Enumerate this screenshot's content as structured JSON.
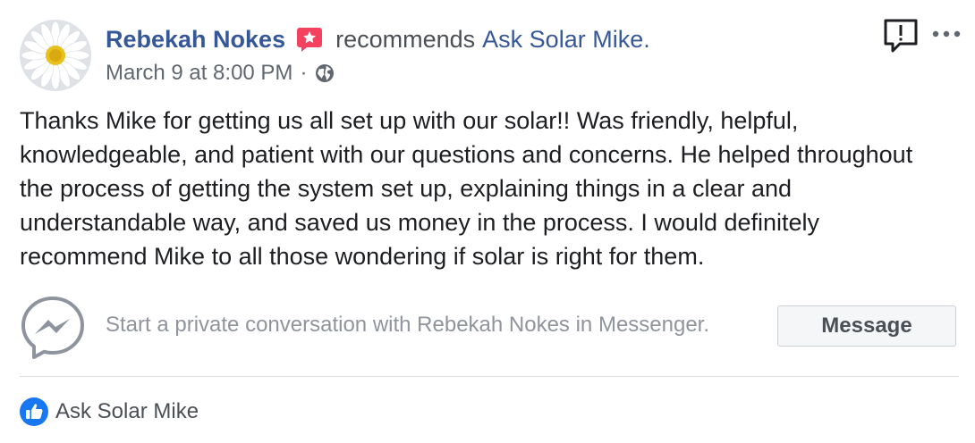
{
  "post": {
    "author": "Rebekah Nokes",
    "action": "recommends",
    "page_name": "Ask Solar Mike.",
    "timestamp": "March 9 at 8:00 PM",
    "separator": "·",
    "privacy_icon": "globe-icon",
    "badge_icon": "recommendation-star-icon",
    "body": "Thanks Mike for getting us all set up with our solar!! Was friendly, helpful, knowledgeable, and patient with our questions and concerns. He helped throughout the process of getting the system set up, explaining things in a clear and understandable way, and saved us money in the process. I would definitely recommend Mike to all those wondering if solar is right for them."
  },
  "messenger": {
    "prompt": "Start a private conversation with Rebekah Nokes in Messenger.",
    "button_label": "Message"
  },
  "likes": {
    "name": "Ask Solar Mike"
  },
  "colors": {
    "link": "#365899",
    "badge": "#f3425f",
    "like": "#1877f2",
    "muted": "#90949c"
  }
}
